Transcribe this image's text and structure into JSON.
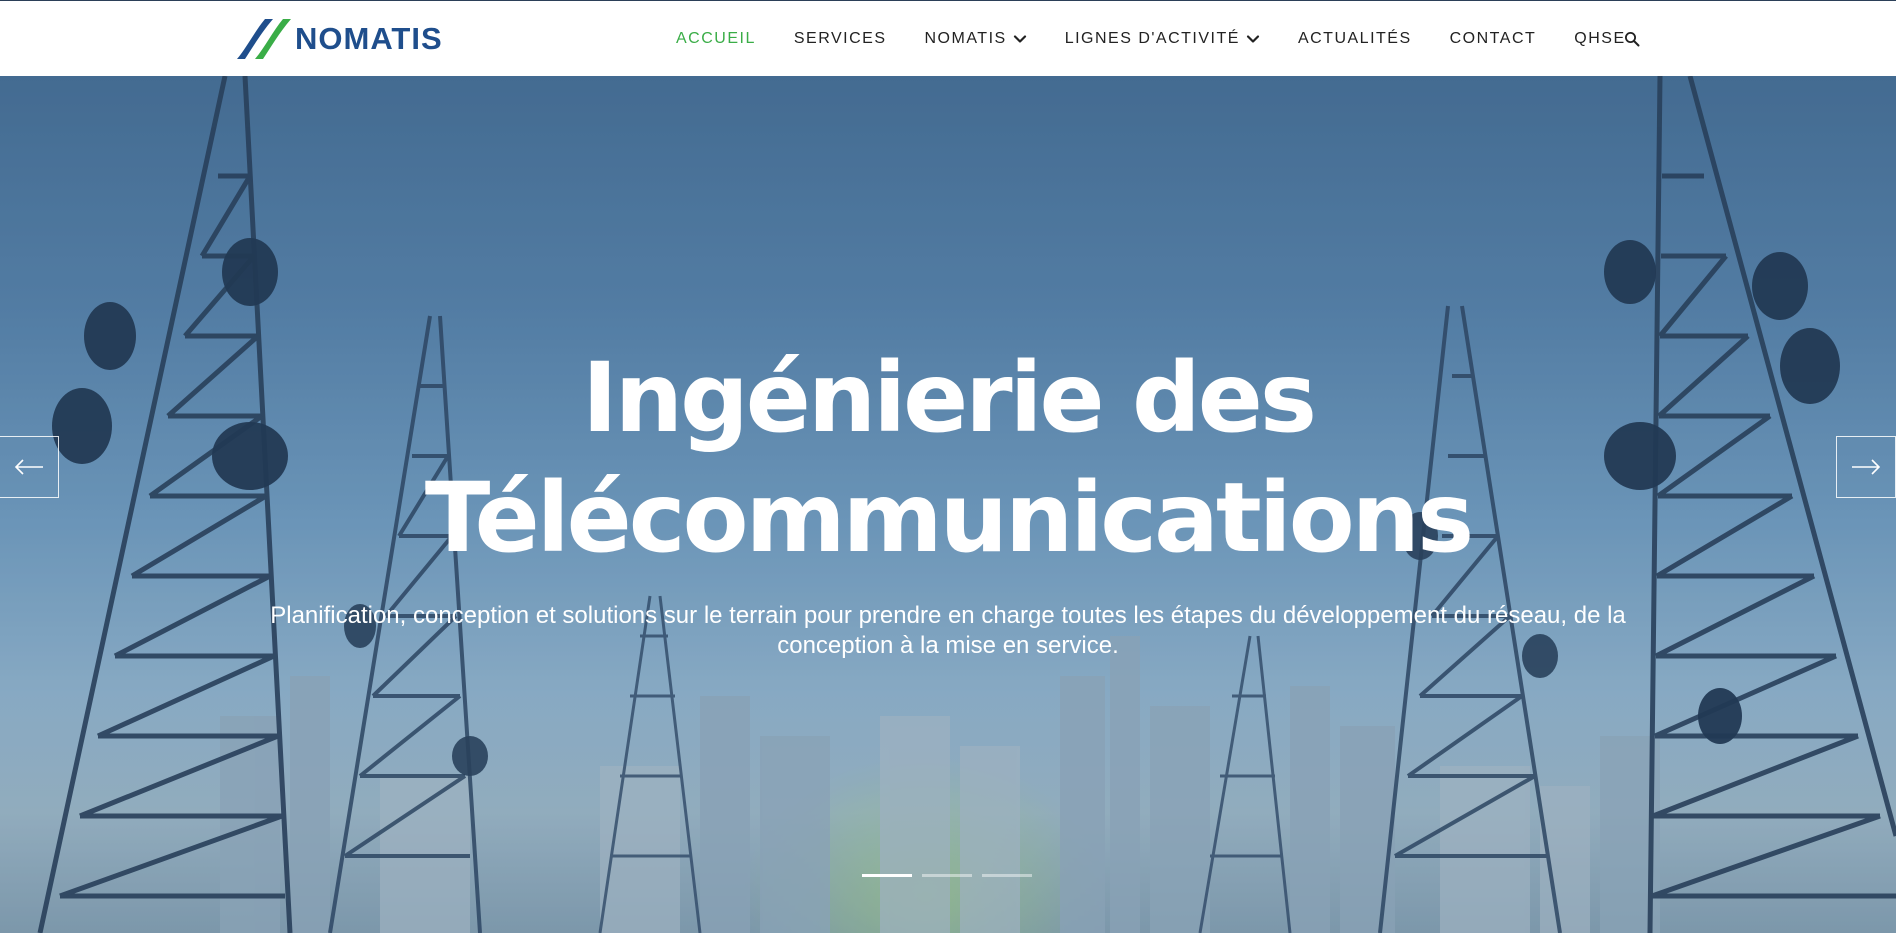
{
  "header": {
    "logo_text": "NOMATIS",
    "nav": [
      {
        "label": "ACCUEIL",
        "active": true,
        "dropdown": false
      },
      {
        "label": "SERVICES",
        "active": false,
        "dropdown": false
      },
      {
        "label": "NOMATIS",
        "active": false,
        "dropdown": true
      },
      {
        "label": "LIGNES D'ACTIVITÉ",
        "active": false,
        "dropdown": true
      },
      {
        "label": "ACTUALITÉS",
        "active": false,
        "dropdown": false
      },
      {
        "label": "CONTACT",
        "active": false,
        "dropdown": false
      },
      {
        "label": "QHSE",
        "active": false,
        "dropdown": false
      }
    ],
    "search_icon": "search-icon"
  },
  "hero": {
    "title_line1": "Ingénierie des",
    "title_line2": "Télécommunications",
    "subtitle": "Planification, conception et solutions sur le terrain pour prendre en charge toutes les étapes du développement du réseau, de la conception à la mise en service.",
    "prev_icon": "arrow-left-icon",
    "next_icon": "arrow-right-icon",
    "slides_total": 3,
    "active_slide": 1
  },
  "colors": {
    "accent_green": "#3aad47",
    "brand_blue": "#1f4e8c",
    "nav_text": "#222222"
  }
}
